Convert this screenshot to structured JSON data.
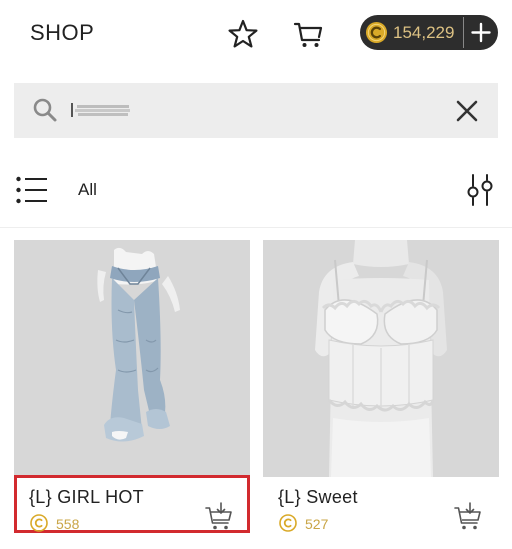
{
  "header": {
    "title": "SHOP",
    "coin_balance": "154,229"
  },
  "search": {
    "value": "",
    "placeholder": ""
  },
  "filter": {
    "category_label": "All"
  },
  "products": [
    {
      "name": "{L} GIRL HOT",
      "price": "558"
    },
    {
      "name": "{L} Sweet",
      "price": "527"
    }
  ],
  "colors": {
    "coin_gold": "#d9a928",
    "pill_bg": "#2d2d2d",
    "highlight_red": "#d22a2f",
    "card_bg": "#d7d7d7"
  },
  "icons": [
    "star-icon",
    "cart-icon",
    "coin-icon",
    "plus-icon",
    "search-icon",
    "close-icon",
    "list-icon",
    "filter-sliders-icon",
    "add-to-cart-icon"
  ]
}
